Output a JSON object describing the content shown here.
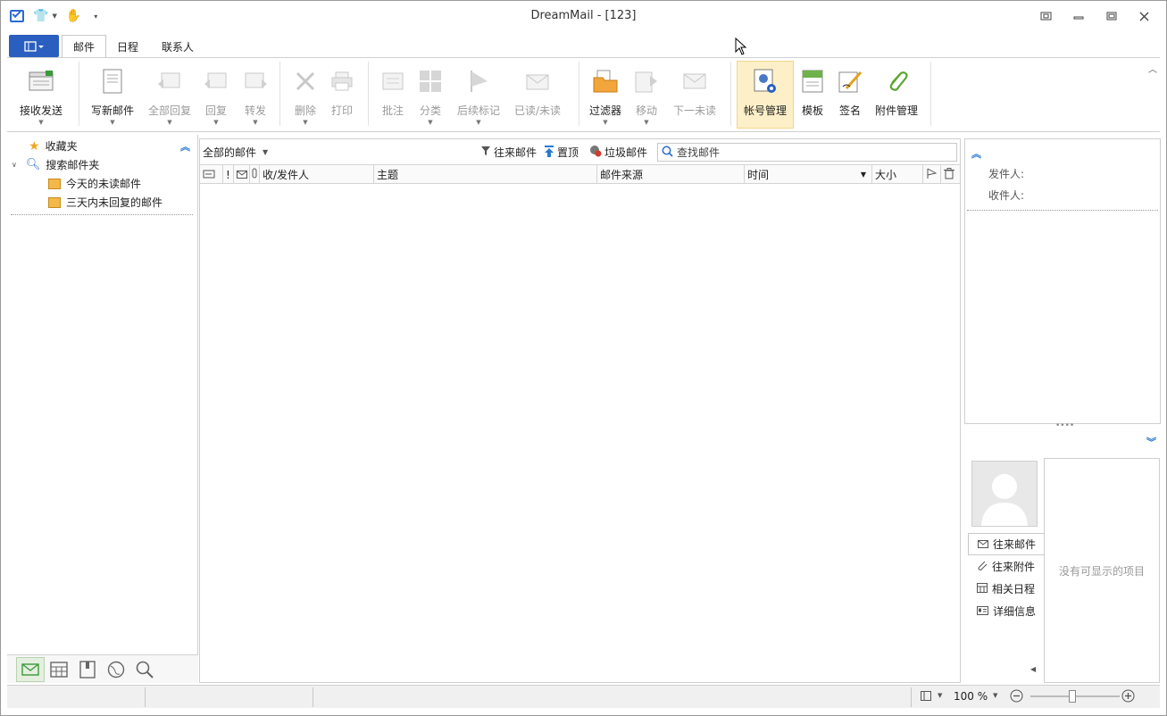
{
  "window": {
    "title": "DreamMail - [123]"
  },
  "ribbon_tabs": [
    "邮件",
    "日程",
    "联系人"
  ],
  "ribbon": {
    "receive_send": "接收发送",
    "compose": "写新邮件",
    "reply_all": "全部回复",
    "reply": "回复",
    "forward": "转发",
    "delete": "删除",
    "print": "打印",
    "annotate": "批注",
    "categorize": "分类",
    "followup": "后续标记",
    "read_unread": "已读/未读",
    "filter": "过滤器",
    "move": "移动",
    "next_unread": "下一未读",
    "account_mgmt": "帐号管理",
    "template": "模板",
    "signature": "签名",
    "attachment_mgmt": "附件管理"
  },
  "sidebar": {
    "favorites": "收藏夹",
    "search_folders": "搜索邮件夹",
    "today_unread": "今天的未读邮件",
    "three_day_unreplied": "三天内未回复的邮件"
  },
  "maillist": {
    "folder_label": "全部的邮件",
    "conversations": "往来邮件",
    "pin_top": "置顶",
    "spam": "垃圾邮件",
    "search_placeholder": "查找邮件",
    "columns": {
      "flag_icon": "!",
      "sender": "收/发件人",
      "subject": "主题",
      "source": "邮件来源",
      "time": "时间",
      "size": "大小"
    }
  },
  "preview": {
    "from_label": "发件人:",
    "to_label": "收件人:"
  },
  "contact_panel": {
    "nav": [
      "往来邮件",
      "往来附件",
      "相关日程",
      "详细信息"
    ],
    "empty": "没有可显示的项目"
  },
  "status": {
    "zoom": "100 %"
  },
  "colors": {
    "accent": "#2a5fbf",
    "highlight": "#fdf0c8"
  }
}
